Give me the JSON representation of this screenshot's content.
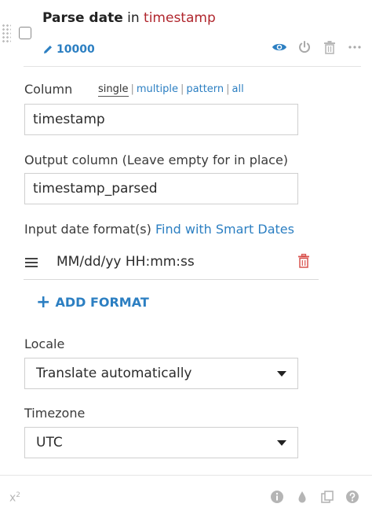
{
  "header": {
    "action": "Parse date",
    "in_word": "in",
    "column": "timestamp",
    "step_id": "10000",
    "icons": [
      "eye-icon",
      "power-icon",
      "trash-icon",
      "more-icon"
    ]
  },
  "column": {
    "label": "Column",
    "modes": {
      "single": "single",
      "multiple": "multiple",
      "pattern": "pattern",
      "all": "all",
      "selected": "single"
    },
    "value": "timestamp"
  },
  "output": {
    "label": "Output column (Leave empty for in place)",
    "value": "timestamp_parsed"
  },
  "date_formats": {
    "label": "Input date format(s)",
    "link": "Find with Smart Dates",
    "formats": [
      "MM/dd/yy HH:mm:ss"
    ],
    "add_label": "ADD FORMAT"
  },
  "locale": {
    "label": "Locale",
    "selected": "Translate automatically"
  },
  "timezone": {
    "label": "Timezone",
    "selected": "UTC"
  },
  "footer": {
    "formula_symbol": "x",
    "formula_exp": "2",
    "icons": [
      "info-icon",
      "drop-icon",
      "copy-icon",
      "help-icon"
    ]
  },
  "colors": {
    "accent": "#2c7fc2",
    "column_red": "#b0262d",
    "delete_red": "#d9534f",
    "muted": "#b5b5b5"
  }
}
